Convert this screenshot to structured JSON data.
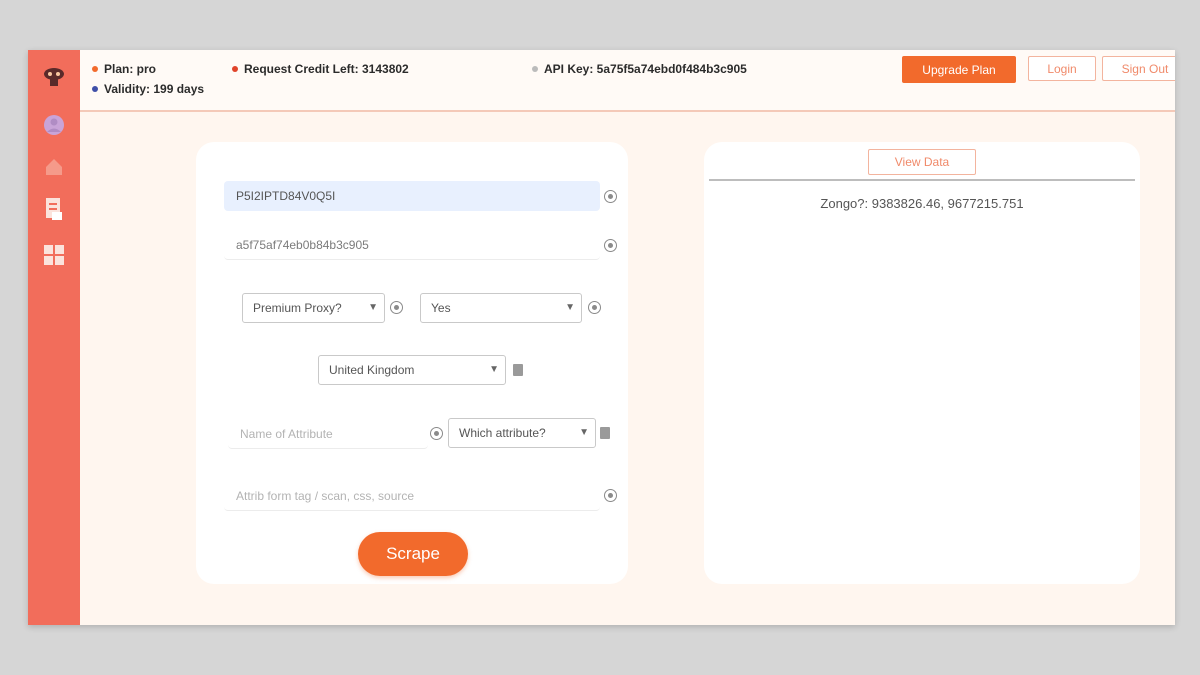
{
  "topbar": {
    "plan": "Plan: pro",
    "request_credit": "Request Credit Left: 3143802",
    "api_key": "API Key: 5a75f5a74ebd0f484b3c905",
    "validity": "Validity: 199 days",
    "upgrade_label": "Upgrade Plan",
    "login_label": "Login",
    "signout_label": "Sign Out"
  },
  "sidebar": {
    "icons": [
      "logo-icon",
      "user-icon",
      "home-icon",
      "document-icon",
      "dashboard-icon"
    ]
  },
  "form": {
    "proxy_id": "P5I2IPTD84V0Q5I",
    "api_key_value": "a5f75af74eb0b84b3c905",
    "proxy_type": "Premium Proxy?",
    "render_value": "Yes",
    "country": "United Kingdom",
    "attribute_name_placeholder": "Name of Attribute",
    "attribute_select": "Which attribute?",
    "extra_placeholder": "Attrib form tag / scan, css, source",
    "scrape_label": "Scrape"
  },
  "results": {
    "view_label": "View Data",
    "line": "Zongo?: 9383826.46, 9677215.751"
  },
  "colors": {
    "accent": "#f26a2c",
    "sidebar": "#f26d5b",
    "background": "#fff6ef"
  }
}
